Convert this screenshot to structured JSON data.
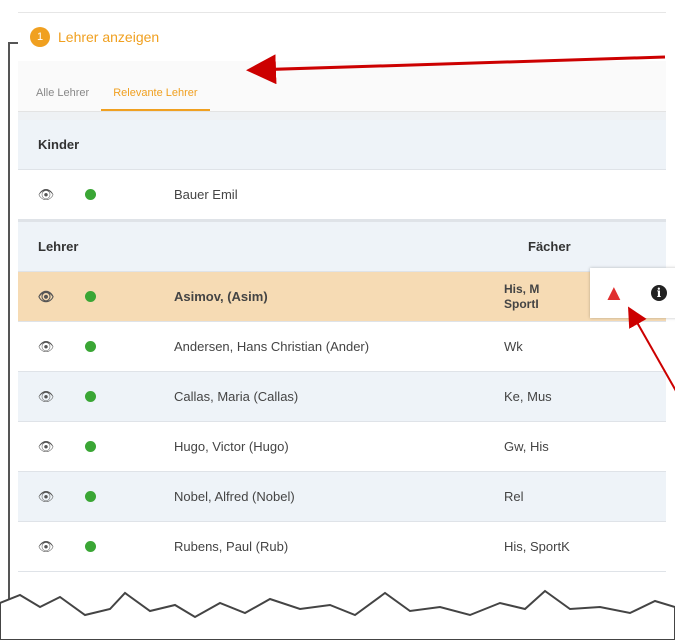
{
  "header": {
    "badge": "1",
    "title": "Lehrer anzeigen"
  },
  "tabs": [
    {
      "label": "Alle Lehrer",
      "active": false
    },
    {
      "label": "Relevante Lehrer",
      "active": true
    }
  ],
  "kinder": {
    "heading": "Kinder",
    "rows": [
      {
        "name": "Bauer Emil"
      }
    ]
  },
  "lehrer": {
    "heading": "Lehrer",
    "subjects_heading": "Fächer",
    "rows": [
      {
        "name": "Asimov, (Asim)",
        "subjects": "His, M\nSportI",
        "highlight": true
      },
      {
        "name": "Andersen, Hans Christian (Ander)",
        "subjects": "Wk"
      },
      {
        "name": "Callas, Maria (Callas)",
        "subjects": "Ke, Mus"
      },
      {
        "name": "Hugo, Victor (Hugo)",
        "subjects": "Gw, His"
      },
      {
        "name": "Nobel, Alfred (Nobel)",
        "subjects": "Rel"
      },
      {
        "name": "Rubens, Paul (Rub)",
        "subjects": "His, SportK"
      }
    ]
  },
  "popup": {
    "warning_icon": "warning-icon",
    "info_icon": "info-icon"
  },
  "icons": {
    "eye": "eye-icon",
    "status": "status-dot-icon"
  },
  "colors": {
    "accent": "#f0a020",
    "status_green": "#3aa635",
    "highlight_row": "#f6dbb4",
    "alt_row": "#eef3f8",
    "annotation_arrow": "#cc0000",
    "warning": "#e03030"
  }
}
